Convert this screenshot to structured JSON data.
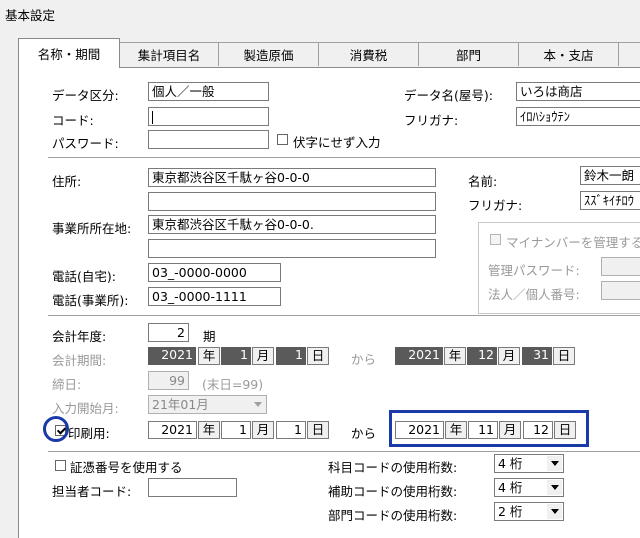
{
  "window": {
    "title": "基本設定"
  },
  "tabs": [
    "名称・期間",
    "集計項目名",
    "製造原価",
    "消費税",
    "部門",
    "本・支店"
  ],
  "basic": {
    "data_kubun_label": "データ区分:",
    "data_kubun_value": "個人／一般",
    "code_label": "コード:",
    "code_value": "",
    "password_label": "パスワード:",
    "password_value": "",
    "fuseji_label": "伏字にせず入力",
    "data_name_label": "データ名(屋号):",
    "data_name_value": "いろは商店",
    "furigana_label": "フリガナ:",
    "furigana_value": "ｲﾛﾊｼｮｳﾃﾝ"
  },
  "address": {
    "jusho_label": "住所:",
    "jusho_value": "東京都渋谷区千駄ヶ谷0-0-0",
    "jusho_value2": "",
    "office_label": "事業所所在地:",
    "office_value": "東京都渋谷区千駄ヶ谷0-0-0.",
    "office_value2": "",
    "tel_home_label": "電話(自宅):",
    "tel_home_value": "03_-0000-0000",
    "tel_office_label": "電話(事業所):",
    "tel_office_value": "03_-0000-1111",
    "name_label": "名前:",
    "name_value": "鈴木一朗",
    "name_furigana_label": "フリガナ:",
    "name_furigana_value": "ｽｽﾞｷｲﾁﾛｳ"
  },
  "mynumber": {
    "manage_label": "マイナンバーを管理する",
    "admin_password_label": "管理パスワード:",
    "corp_number_label": "法人／個人番号:"
  },
  "fiscal": {
    "year_label": "会計年度:",
    "year_value": "2",
    "year_unit": "期",
    "period_label": "会計期間:",
    "from_year": "2021",
    "from_month": "1",
    "from_day": "1",
    "kara": "から",
    "to_year": "2021",
    "to_month": "12",
    "to_day": "31",
    "nen": "年",
    "tsuki": "月",
    "hi": "日",
    "closing_label": "締日:",
    "closing_value": "99",
    "closing_note": "(末日=99)",
    "input_start_label": "入力開始月:",
    "input_start_value": "21年01月",
    "print_label": "印刷用:",
    "print_from_year": "2021",
    "print_from_month": "1",
    "print_from_day": "1",
    "print_to_year": "2021",
    "print_to_month": "11",
    "print_to_day": "12"
  },
  "other": {
    "voucher_label": "証憑番号を使用する",
    "person_code_label": "担当者コード:",
    "person_code_value": "",
    "account_digits_label": "科目コードの使用桁数:",
    "account_digits_value": "4 桁",
    "sub_digits_label": "補助コードの使用桁数:",
    "sub_digits_value": "4 桁",
    "dept_digits_label": "部門コードの使用桁数:",
    "dept_digits_value": "2 桁"
  },
  "colors": {
    "highlight": "#1a3aa8",
    "dark_field": "#5a5a5a"
  }
}
